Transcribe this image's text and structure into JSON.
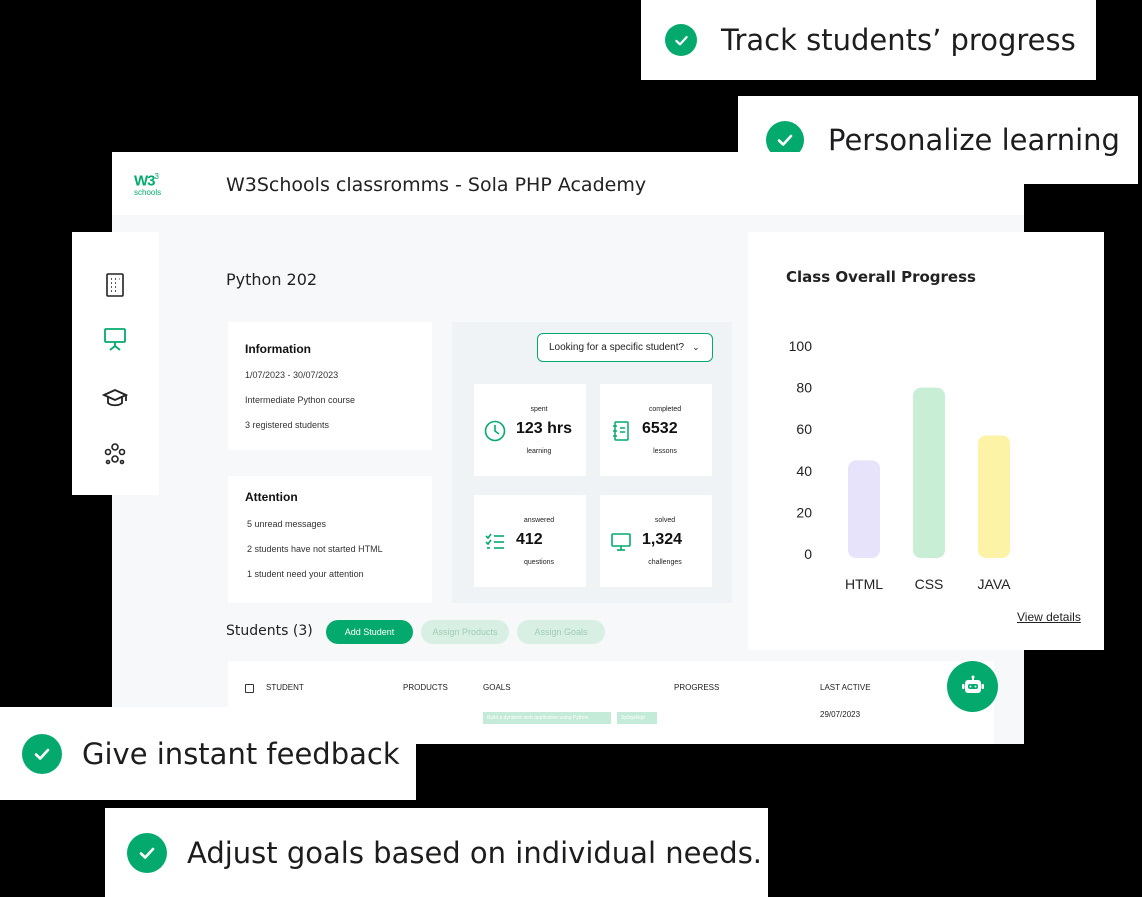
{
  "callouts": {
    "track": "Track students’ progress",
    "personalize": "Personalize learning",
    "feedback": "Give instant feedback",
    "goals": "Adjust goals based on individual needs."
  },
  "header": {
    "logo_main": "W3",
    "logo_sub": "schools",
    "title": "W3Schools classromms - Sola PHP Academy"
  },
  "sidebar": {
    "icons": [
      "building-icon",
      "presentation-icon",
      "graduation-cap-icon",
      "users-icon"
    ]
  },
  "course": {
    "title": "Python 202"
  },
  "information": {
    "heading": "Information",
    "lines": [
      "1/07/2023 - 30/07/2023",
      "Intermediate Python course",
      "3 registered students"
    ]
  },
  "attention": {
    "heading": "Attention",
    "lines": [
      "5 unread messages",
      "2 students have not started HTML",
      "1 student need your attention"
    ]
  },
  "search": {
    "label": "Looking for a specific student?"
  },
  "stats": [
    {
      "top": "spent",
      "value": "123 hrs",
      "bottom": "learning",
      "icon": "clock-icon"
    },
    {
      "top": "completed",
      "value": "6532",
      "bottom": "lessons",
      "icon": "notebook-icon"
    },
    {
      "top": "answered",
      "value": "412",
      "bottom": "questions",
      "icon": "checklist-icon"
    },
    {
      "top": "solved",
      "value": "1,324",
      "bottom": "challenges",
      "icon": "monitor-icon"
    }
  ],
  "chart": {
    "title": "Class Overall Progress",
    "view_details": "View details"
  },
  "chart_data": {
    "type": "bar",
    "title": "Class Overall Progress",
    "categories": [
      "HTML",
      "CSS",
      "JAVA"
    ],
    "values": [
      45,
      80,
      57
    ],
    "colors": [
      "#e7e3fb",
      "#c8efd6",
      "#fdf3a6"
    ],
    "yticks": [
      0,
      20,
      40,
      60,
      80,
      100
    ],
    "ylim": [
      0,
      100
    ],
    "grid": false,
    "legend": "none"
  },
  "students": {
    "title": "Students (3)",
    "add_label": "Add Student",
    "assign_products_label": "Assign Products",
    "assign_goals_label": "Assign Goals",
    "columns": [
      "STUDENT",
      "PRODUCTS",
      "GOALS",
      "PROGRESS",
      "LAST ACTIVE"
    ],
    "row": {
      "goal_tags": [
        "Build a dynamic web application using Python",
        "Sp0qaRqd"
      ],
      "last_active": "29/07/2023"
    }
  },
  "colors": {
    "accent": "#04aa6d",
    "page_bg": "#f6f8fa"
  }
}
